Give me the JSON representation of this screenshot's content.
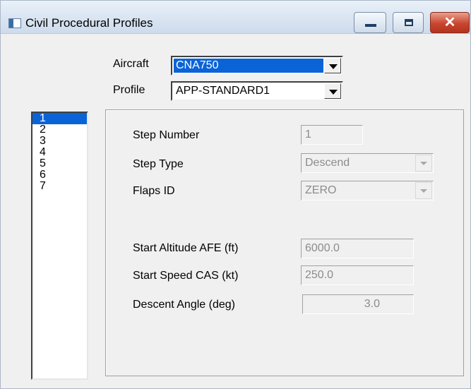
{
  "window": {
    "title": "Civil Procedural Profiles",
    "close_symbol": "✕",
    "icon_names": {
      "app": "app-icon",
      "minimize": "minimize-icon",
      "maximize": "maximize-icon",
      "close": "close-icon"
    }
  },
  "selectors": {
    "aircraft_label": "Aircraft",
    "aircraft_value": "CNA750",
    "profile_label": "Profile",
    "profile_value": "APP-STANDARD1"
  },
  "steps_list": {
    "items": [
      "1",
      "2",
      "3",
      "4",
      "5",
      "6",
      "7"
    ],
    "selected_index": 0
  },
  "step_form": {
    "step_number_label": "Step Number",
    "step_number_value": "1",
    "step_type_label": "Step Type",
    "step_type_value": "Descend",
    "flaps_id_label": "Flaps ID",
    "flaps_id_value": "ZERO",
    "start_altitude_label": "Start Altitude AFE  (ft)",
    "start_altitude_value": "6000.0",
    "start_speed_label": "Start Speed CAS  (kt)",
    "start_speed_value": "250.0",
    "descent_angle_label": "Descent Angle (deg)",
    "descent_angle_value": "3.0"
  },
  "colors": {
    "selection": "#0a64d8",
    "disabled_text": "#8c8c8c",
    "close_button": "#c9452e"
  }
}
